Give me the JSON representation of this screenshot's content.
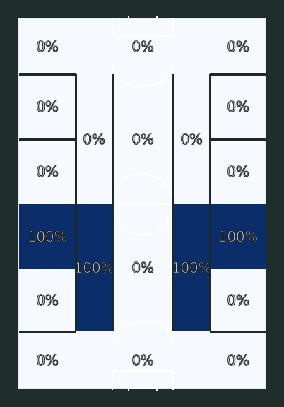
{
  "colors": {
    "background": "#202e2b",
    "pitch": "#f6f9fe",
    "line": "#ffffff",
    "divider": "#1c2927",
    "zone_empty": "#f6f9fe",
    "zone_filled": "#0b2d69",
    "label_fill_empty": "#f6f9fe",
    "label_fill_filled": "#f7e9c6",
    "label_stroke": "#1b2321"
  },
  "zones": [
    {
      "id": "left-top",
      "label": "0%",
      "value": 0
    },
    {
      "id": "center-top",
      "label": "0%",
      "value": 0
    },
    {
      "id": "right-top",
      "label": "0%",
      "value": 0
    },
    {
      "id": "left-upper",
      "label": "0%",
      "value": 0
    },
    {
      "id": "right-upper",
      "label": "0%",
      "value": 0
    },
    {
      "id": "halfspace-left-top",
      "label": "0%",
      "value": 0
    },
    {
      "id": "central-top",
      "label": "0%",
      "value": 0
    },
    {
      "id": "halfspace-right-top",
      "label": "0%",
      "value": 0
    },
    {
      "id": "left-mid-upper",
      "label": "0%",
      "value": 0
    },
    {
      "id": "right-mid-upper",
      "label": "0%",
      "value": 0
    },
    {
      "id": "left-mid-lower",
      "label": "100%",
      "value": 100
    },
    {
      "id": "right-mid-lower",
      "label": "100%",
      "value": 100
    },
    {
      "id": "halfspace-left-bottom",
      "label": "100%",
      "value": 100
    },
    {
      "id": "central-bottom",
      "label": "0%",
      "value": 0
    },
    {
      "id": "halfspace-right-bottom",
      "label": "100%",
      "value": 100
    },
    {
      "id": "left-lower",
      "label": "0%",
      "value": 0
    },
    {
      "id": "right-lower",
      "label": "0%",
      "value": 0
    },
    {
      "id": "left-bottom",
      "label": "0%",
      "value": 0
    },
    {
      "id": "center-bottom",
      "label": "0%",
      "value": 0
    },
    {
      "id": "right-bottom",
      "label": "0%",
      "value": 0
    }
  ]
}
